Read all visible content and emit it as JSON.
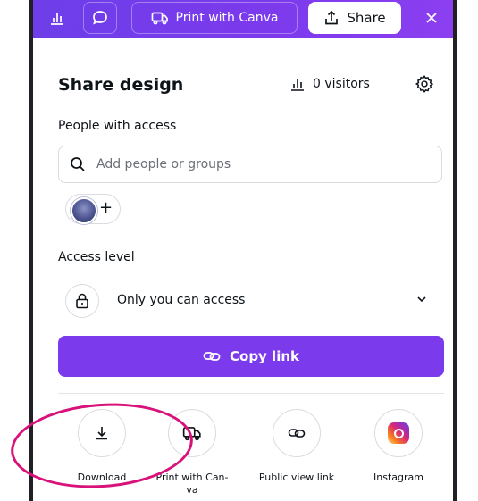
{
  "toolbar": {
    "chart_icon": "bar-chart-icon",
    "comment_icon": "comment-icon",
    "print_label": "Print with Canva",
    "share_label": "Share",
    "close_icon": "close-icon"
  },
  "panel": {
    "title": "Share design",
    "visitors": "0 visitors",
    "people_label": "People with access",
    "search_placeholder": "Add people or groups",
    "add_icon": "+",
    "access_label": "Access level",
    "access_value": "Only you can access",
    "copy_link": "Copy link"
  },
  "share_options": [
    {
      "label": "Download",
      "icon": "download-icon"
    },
    {
      "label": "Print with Can-\nva",
      "icon": "truck-icon"
    },
    {
      "label": "Public view link",
      "icon": "link-icon"
    },
    {
      "label": "Instagram",
      "icon": "instagram-icon"
    }
  ],
  "colors": {
    "toolbar_start": "#6d3ee9",
    "toolbar_end": "#8b3ff0",
    "accent": "#7c3aed",
    "annotation": "#d8127a"
  }
}
